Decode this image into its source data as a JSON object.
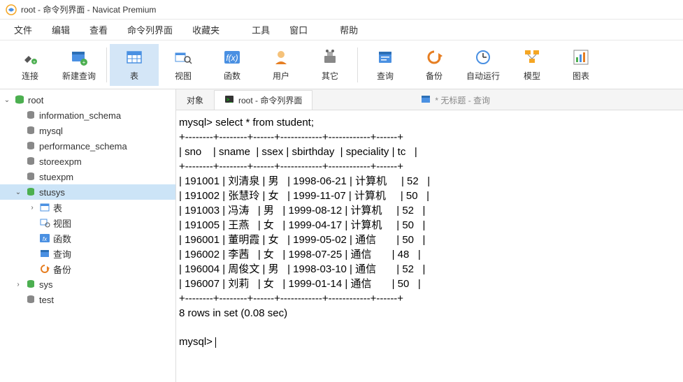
{
  "window": {
    "title": "root - 命令列界面 - Navicat Premium"
  },
  "menu": [
    "文件",
    "编辑",
    "查看",
    "命令列界面",
    "收藏夹",
    "工具",
    "窗口",
    "帮助"
  ],
  "toolbar": [
    {
      "label": "连接",
      "icon": "plug"
    },
    {
      "label": "新建查询",
      "icon": "query"
    },
    {
      "label": "表",
      "icon": "table",
      "active": true
    },
    {
      "label": "视图",
      "icon": "view"
    },
    {
      "label": "函数",
      "icon": "fx"
    },
    {
      "label": "用户",
      "icon": "user"
    },
    {
      "label": "其它",
      "icon": "other"
    },
    {
      "label": "查询",
      "icon": "query2"
    },
    {
      "label": "备份",
      "icon": "backup"
    },
    {
      "label": "自动运行",
      "icon": "autorun"
    },
    {
      "label": "模型",
      "icon": "model"
    },
    {
      "label": "图表",
      "icon": "chart"
    }
  ],
  "tree": {
    "root": "root",
    "dbs": [
      "information_schema",
      "mysql",
      "performance_schema",
      "storeexpm",
      "stuexpm"
    ],
    "active_db": "stusys",
    "active_children": [
      "表",
      "视图",
      "函数",
      "查询",
      "备份"
    ],
    "after": [
      "sys",
      "test"
    ]
  },
  "tabs": {
    "t1": "对象",
    "t2": "root - 命令列界面",
    "t3": "* 无标题 - 查询"
  },
  "console": {
    "prompt1": "mysql> select * from student;",
    "divider": "+--------+--------+------+------------+------------+------+",
    "header": "| sno    | sname  | ssex | sbirthday  | speciality | tc   |",
    "rows": [
      "| 191001 | 刘清泉 | 男   | 1998-06-21 | 计算机     | 52   |",
      "| 191002 | 张慧玲 | 女   | 1999-11-07 | 计算机     | 50   |",
      "| 191003 | 冯涛   | 男   | 1999-08-12 | 计算机     | 52   |",
      "| 191005 | 王燕   | 女   | 1999-04-17 | 计算机     | 50   |",
      "| 196001 | 董明霞 | 女   | 1999-05-02 | 通信       | 50   |",
      "| 196002 | 李茜   | 女   | 1998-07-25 | 通信       | 48   |",
      "| 196004 | 周俊文 | 男   | 1998-03-10 | 通信       | 52   |",
      "| 196007 | 刘莉   | 女   | 1999-01-14 | 通信       | 50   |"
    ],
    "summary": "8 rows in set (0.08 sec)",
    "prompt2": "mysql> "
  },
  "chart_data": {
    "type": "table",
    "title": "select * from student",
    "columns": [
      "sno",
      "sname",
      "ssex",
      "sbirthday",
      "speciality",
      "tc"
    ],
    "rows": [
      [
        "191001",
        "刘清泉",
        "男",
        "1998-06-21",
        "计算机",
        52
      ],
      [
        "191002",
        "张慧玲",
        "女",
        "1999-11-07",
        "计算机",
        50
      ],
      [
        "191003",
        "冯涛",
        "男",
        "1999-08-12",
        "计算机",
        52
      ],
      [
        "191005",
        "王燕",
        "女",
        "1999-04-17",
        "计算机",
        50
      ],
      [
        "196001",
        "董明霞",
        "女",
        "1999-05-02",
        "通信",
        50
      ],
      [
        "196002",
        "李茜",
        "女",
        "1998-07-25",
        "通信",
        48
      ],
      [
        "196004",
        "周俊文",
        "男",
        "1998-03-10",
        "通信",
        52
      ],
      [
        "196007",
        "刘莉",
        "女",
        "1999-01-14",
        "通信",
        50
      ]
    ],
    "row_count": 8,
    "elapsed_sec": 0.08
  }
}
